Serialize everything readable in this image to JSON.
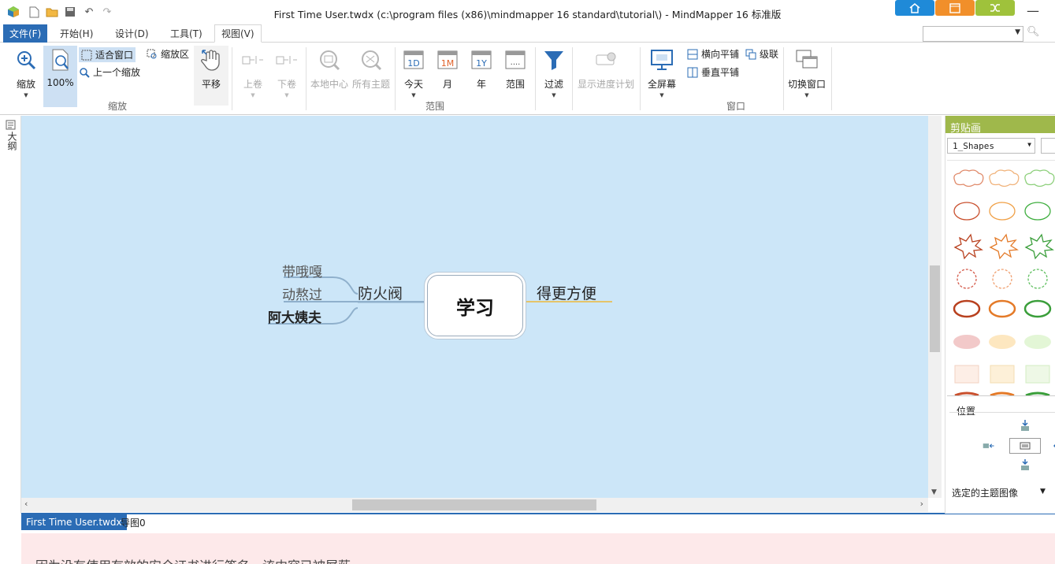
{
  "window": {
    "title": "First Time User.twdx (c:\\program files (x86)\\mindmapper 16 standard\\tutorial\\) - MindMapper 16 标准版",
    "minimize_glyph": "—"
  },
  "colors": {
    "accent_blue": "#2b6cb5",
    "home_button": "#1f8ad8",
    "calendar_button": "#f18f2a",
    "green_button": "#9fc23b",
    "canvas_bg": "#cce6f8",
    "panel_header": "#9fb84b",
    "notice_bg": "#fde9ea"
  },
  "quick_access": {
    "icons": [
      "app-logo-icon",
      "new-file-icon",
      "open-folder-icon",
      "save-icon",
      "undo-icon",
      "redo-icon"
    ]
  },
  "menu": {
    "tabs": [
      {
        "label": "文件(F)"
      },
      {
        "label": "开始(H)"
      },
      {
        "label": "设计(D)"
      },
      {
        "label": "工具(T)"
      },
      {
        "label": "视图(V)"
      }
    ]
  },
  "ribbon": {
    "zoom": {
      "zoom_label": "缩放",
      "percent_label": "100%",
      "fit_window": "适合窗口",
      "zoom_area": "缩放区",
      "prev_zoom": "上一个缩放",
      "pan": "平移",
      "group_label": "缩放"
    },
    "scroll": {
      "roll_up": "上卷",
      "roll_down": "下卷",
      "local_center": "本地中心",
      "all_topics": "所有主题"
    },
    "range": {
      "today": "今天",
      "month": "月",
      "year": "年",
      "range": "范围",
      "today_icon_text": "1D",
      "month_icon_text": "1M",
      "year_icon_text": "1Y",
      "range_icon_text": "....",
      "group_label": "范围"
    },
    "filter": {
      "label": "过滤",
      "progress_plan": "显示进度计划"
    },
    "window": {
      "fullscreen": "全屏幕",
      "tile_horizontal": "横向平铺",
      "cascade": "级联",
      "tile_vertical": "垂直平铺",
      "switch_window": "切换窗口",
      "group_label": "窗口"
    }
  },
  "left_strip": {
    "outline_label": "大纲"
  },
  "mindmap": {
    "central": "学习",
    "topic_left": "防火阀",
    "topic_right": "得更方便",
    "subtopics": [
      "带哦嘎",
      "动熬过",
      "阿大姨夫"
    ]
  },
  "doc_tabs": [
    {
      "label": "First Time User.twdx"
    },
    {
      "label": "导图0"
    }
  ],
  "notice": {
    "text": "因为没有使用有效的安全证书进行签名，该内容已被屏蔽"
  },
  "right_panel": {
    "title": "剪贴画",
    "category": "1_Shapes",
    "position_label": "位置",
    "selected_image": "选定的主题图像"
  }
}
